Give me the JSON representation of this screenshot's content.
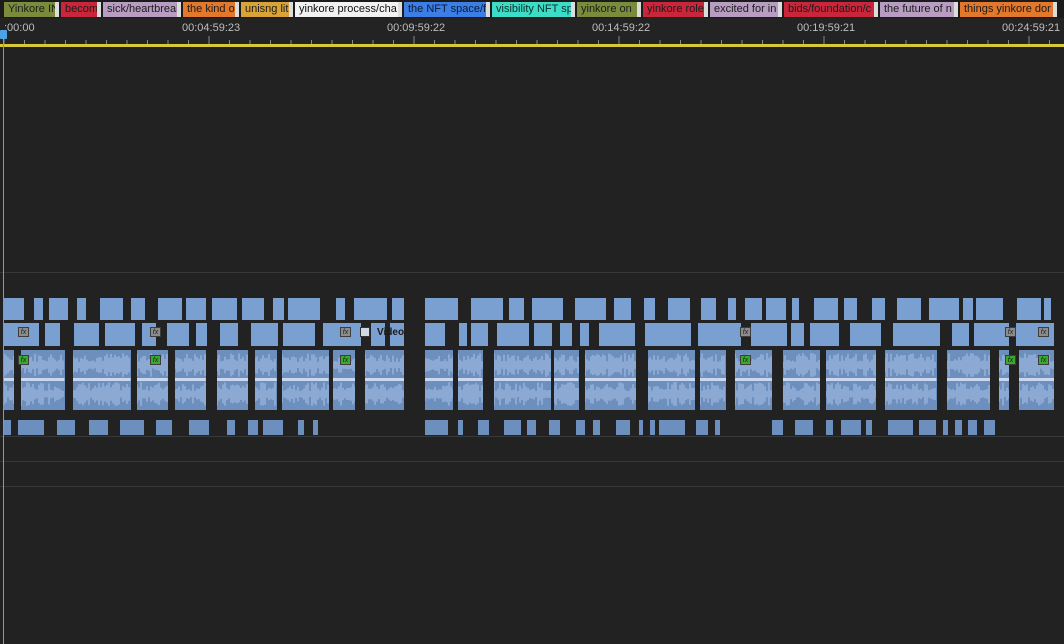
{
  "markers": [
    {
      "label": "Yinkore IN",
      "color": "#7a8b3c",
      "text": "#1b1b1b"
    },
    {
      "label": "becoming",
      "color": "#c9263b",
      "text": "#1b1b1b"
    },
    {
      "label": "sick/heartbreak",
      "color": "#b99cc2",
      "text": "#1b1b1b"
    },
    {
      "label": "the kind of",
      "color": "#e3772b",
      "text": "#1b1b1b"
    },
    {
      "label": "unisng lit",
      "color": "#d9a337",
      "text": "#1b1b1b"
    },
    {
      "label": "yinkore process/cha",
      "color": "#f2f2f2",
      "text": "#111111"
    },
    {
      "label": "the NFT space/fi",
      "color": "#3a7ee6",
      "text": "#0c1a33"
    },
    {
      "label": "visibility NFT sp",
      "color": "#3ddcc6",
      "text": "#0a2e29"
    },
    {
      "label": "yinkore on",
      "color": "#7a8b3c",
      "text": "#1b1b1b"
    },
    {
      "label": "yinkore role",
      "color": "#c9263b",
      "text": "#1b1b1b"
    },
    {
      "label": "excited for in",
      "color": "#b99cc2",
      "text": "#1b1b1b"
    },
    {
      "label": "bids/foundation/c",
      "color": "#c9263b",
      "text": "#1b1b1b"
    },
    {
      "label": "the future of n",
      "color": "#b99cc2",
      "text": "#1b1b1b"
    },
    {
      "label": "things yinkore dor",
      "color": "#e3772b",
      "text": "#1b1b1b"
    }
  ],
  "ruler": {
    "timecodes": [
      ":00:00",
      "00:04:59:23",
      "00:09:59:22",
      "00:14:59:22",
      "00:19:59:21",
      "00:24:59:21"
    ]
  },
  "tracks": {
    "video_clip_name": "Video"
  },
  "colors": {
    "background": "#222222",
    "clip_blue": "#7aa0d2",
    "playhead": "#56a7e0",
    "work_area": "#d8c93a",
    "fx_audio": "#3ca832",
    "fx_video": "#8c8c8c"
  },
  "icons": {
    "fx_badge": "fx-badge-icon",
    "clip_thumbnail": "clip-thumbnail-icon",
    "playhead": "playhead-icon"
  }
}
